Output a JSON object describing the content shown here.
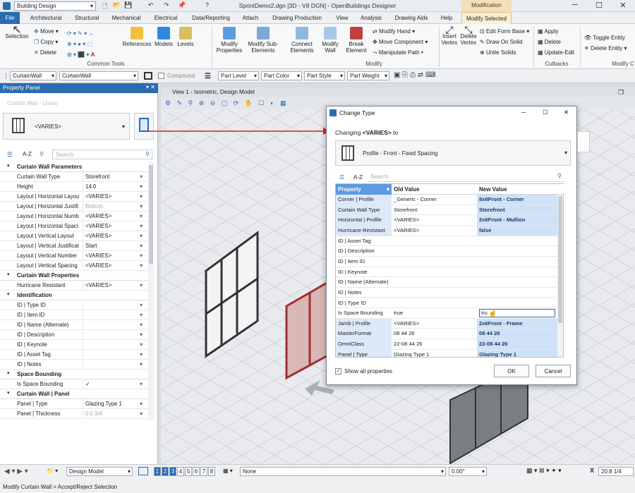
{
  "app": {
    "title": "SprintDemo2.dgn [3D - V8 DGN] - OpenBuildings Designer",
    "workspace": "Building Design",
    "modification_label": "Modification"
  },
  "tabs": [
    "File",
    "Architectural",
    "Structural",
    "Mechanical",
    "Electrical",
    "Data/Reporting",
    "Attach",
    "Drawing Production",
    "View",
    "Analysis",
    "Drawing Aids",
    "Help",
    "Modify Selected"
  ],
  "ribbon": {
    "selection": "Selection",
    "move": "Move",
    "copy": "Copy",
    "delete": "Delete",
    "references": "References",
    "models": "Models",
    "levels": "Levels",
    "common_tools": "Common Tools",
    "modify_properties": "Modify Properties",
    "modify_sub_elements": "Modify Sub-Elements",
    "connect_elements": "Connect Elements",
    "modify_wall": "Modify Wall",
    "break_element": "Break Element",
    "modify_hand": "Modify Hand",
    "move_component": "Move Component",
    "manipulate_path": "Manipulate Path",
    "modify_group": "Modify",
    "insert_vertex": "Insert Vertex",
    "delete_vertex": "Delete Vertex",
    "edit_form_base": "Edit Form Base",
    "draw_on_solid": "Draw On Solid",
    "unite_solids": "Unite Solids",
    "apply": "Apply",
    "delete2": "Delete",
    "update_edit": "Update-Edit",
    "cutbacks": "Cutbacks",
    "toggle_entity": "Toggle Entity",
    "delete_entity": "Delete Entity",
    "modify_c": "Modify C"
  },
  "toolbar2": {
    "type1": "CurtainWall",
    "type2": "CurtainWall",
    "compound": "Compound",
    "part_level": "Part Level",
    "part_color": "Part Color",
    "part_style": "Part Style",
    "part_weight": "Part Weight"
  },
  "property_panel": {
    "title": "Property Panel",
    "element_type": "Curtain Wall - Users",
    "varies": "<VARIES>",
    "search_placeholder": "Search",
    "az": "A-Z",
    "sections": [
      {
        "name": "Curtain Wall Parameters",
        "rows": [
          [
            "Curtain Wall Type",
            "Storefront"
          ],
          [
            "Height",
            "14:0"
          ],
          [
            "Layout | Horizontal Layou",
            "<VARIES>"
          ],
          [
            "Layout | Horizontal Justifi",
            "Bottom"
          ],
          [
            "Layout | Horizontal Numb",
            "<VARIES>"
          ],
          [
            "Layout | Horizontal Spaci",
            "<VARIES>"
          ],
          [
            "Layout | Vertical Layout",
            "<VARIES>"
          ],
          [
            "Layout | Vertical Justificat",
            "Start"
          ],
          [
            "Layout | Vertical Number",
            "<VARIES>"
          ],
          [
            "Layout | Vertical Spacing",
            "<VARIES>"
          ]
        ]
      },
      {
        "name": "Curtain Wall Properties",
        "rows": [
          [
            "Hurricane Resistant",
            "<VARIES>"
          ]
        ]
      },
      {
        "name": "Identification",
        "rows": [
          [
            "ID | Type ID",
            ""
          ],
          [
            "ID | Item ID",
            ""
          ],
          [
            "ID | Name (Alternate)",
            ""
          ],
          [
            "ID | Description",
            ""
          ],
          [
            "ID | Keynote",
            ""
          ],
          [
            "ID | Asset Tag",
            ""
          ],
          [
            "ID | Notes",
            ""
          ]
        ]
      },
      {
        "name": "Space Bounding",
        "rows": [
          [
            "Is Space Bounding",
            "✓"
          ]
        ]
      },
      {
        "name": "Curtain Wall | Panel",
        "rows": [
          [
            "Panel | Type",
            "Glazing Type 1"
          ],
          [
            "Panel | Thickness",
            "0:0 3/4"
          ]
        ]
      }
    ]
  },
  "view": {
    "title": "View 1 - Isometric, Design Model"
  },
  "dialog": {
    "title": "Change Type",
    "changing_prefix": "Changing",
    "changing_value": "<VARIES>",
    "changing_suffix": "to",
    "target_type": "Profile - Front - Fixed Spacing",
    "az": "A-Z",
    "search_placeholder": "Search",
    "col_property": "Property",
    "col_old": "Old Value",
    "col_new": "New Value",
    "rows": [
      [
        "Corner | Profile",
        "_Generic - Corner",
        "8x6Front - Corner"
      ],
      [
        "Curtain Wall Type",
        "Storefront",
        "Storefront"
      ],
      [
        "Horizontal | Profile",
        "<VARIES>",
        "2x6Front - Mullion"
      ],
      [
        "Hurricane Resistant",
        "<VARIES>",
        "false"
      ],
      [
        "ID | Asset Tag",
        "",
        ""
      ],
      [
        "ID | Description",
        "",
        ""
      ],
      [
        "ID | Item ID",
        "",
        ""
      ],
      [
        "ID | Keynote",
        "",
        ""
      ],
      [
        "ID | Name (Alternate)",
        "",
        ""
      ],
      [
        "ID | Notes",
        "",
        ""
      ],
      [
        "ID | Type ID",
        "",
        ""
      ],
      [
        "Is Space Bounding",
        "true",
        "tru"
      ],
      [
        "Jamb | Profile",
        "<VARIES>",
        "2x6Front - Frame"
      ],
      [
        "MasterFormat",
        "08 44 26",
        "08 44 26"
      ],
      [
        "OmniClass",
        "22-08 44 26",
        "22-08 44 26"
      ],
      [
        "Panel | Type",
        "Glazing Type 1",
        "Glazing Type 1"
      ]
    ],
    "show_all": "Show all properties",
    "ok": "OK",
    "cancel": "Cancel"
  },
  "status": {
    "model": "Design Model",
    "views": [
      "1",
      "2",
      "3",
      "4",
      "5",
      "6",
      "7",
      "8"
    ],
    "level": "None",
    "angle": "0.00°",
    "x_label": "X",
    "x_value": "20:8 1/4",
    "prompt": "Modify Curtain Wall > Accept/Reject Selection"
  },
  "colors": {
    "accent": "#2b6cb0",
    "highlight": "#cfe1f6",
    "arrow": "#e02020"
  }
}
